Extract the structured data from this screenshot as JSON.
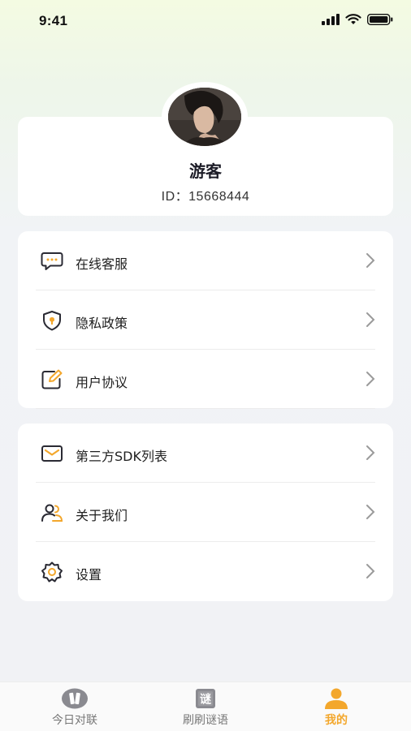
{
  "status": {
    "time": "9:41"
  },
  "profile": {
    "name": "游客",
    "id": "ID：15668444"
  },
  "menu1": [
    {
      "label": "在线客服",
      "icon": "chat-bubble-icon"
    },
    {
      "label": "隐私政策",
      "icon": "shield-icon"
    },
    {
      "label": "用户协议",
      "icon": "edit-document-icon"
    }
  ],
  "menu2": [
    {
      "label": "第三方SDK列表",
      "icon": "envelope-icon"
    },
    {
      "label": "关于我们",
      "icon": "users-icon"
    },
    {
      "label": "设置",
      "icon": "settings-gear-icon"
    }
  ],
  "tabs": [
    {
      "label": "今日对联",
      "icon": "couplet-icon"
    },
    {
      "label": "刷刷谜语",
      "icon": "riddle-book-icon"
    },
    {
      "label": "我的",
      "icon": "profile-person-icon",
      "active": true
    }
  ],
  "colors": {
    "accent": "#f3a72c",
    "icon_dark": "#2a2a33"
  }
}
